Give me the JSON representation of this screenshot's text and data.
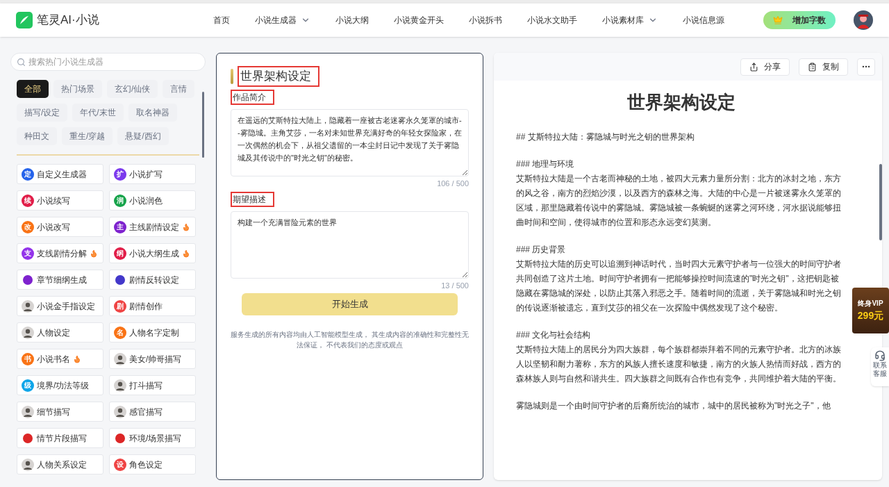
{
  "header": {
    "logo_text": "笔灵AI·小说",
    "nav": [
      {
        "label": "首页",
        "dropdown": false
      },
      {
        "label": "小说生成器",
        "dropdown": true
      },
      {
        "label": "小说大纲",
        "dropdown": false
      },
      {
        "label": "小说黄金开头",
        "dropdown": false
      },
      {
        "label": "小说拆书",
        "dropdown": false
      },
      {
        "label": "小说水文助手",
        "dropdown": false
      },
      {
        "label": "小说素材库",
        "dropdown": true
      },
      {
        "label": "小说信息源",
        "dropdown": false
      }
    ],
    "cta": "增加字数"
  },
  "sidebar": {
    "search_placeholder": "搜索热门小说生成器",
    "categories": [
      {
        "label": "全部",
        "selected": true
      },
      {
        "label": "热门场景",
        "selected": false
      },
      {
        "label": "玄幻/仙侠",
        "selected": false
      },
      {
        "label": "言情",
        "selected": false
      },
      {
        "label": "描写/设定",
        "selected": false
      },
      {
        "label": "年代/末世",
        "selected": false
      },
      {
        "label": "取名神器",
        "selected": false
      },
      {
        "label": "种田文",
        "selected": false
      },
      {
        "label": "重生/穿越",
        "selected": false
      },
      {
        "label": "悬疑/西幻",
        "selected": false
      }
    ],
    "tools": [
      {
        "label": "自定义生成器",
        "kind": "glyph",
        "glyph": "定",
        "color": "#2563eb",
        "hot": false
      },
      {
        "label": "小说扩写",
        "kind": "glyph",
        "glyph": "扩",
        "color": "#7c3aed",
        "hot": false
      },
      {
        "label": "小说续写",
        "kind": "glyph",
        "glyph": "续",
        "color": "#e11d48",
        "hot": false
      },
      {
        "label": "小说润色",
        "kind": "glyph",
        "glyph": "润",
        "color": "#16a34a",
        "hot": false
      },
      {
        "label": "小说改写",
        "kind": "glyph",
        "glyph": "改",
        "color": "#f97316",
        "hot": false
      },
      {
        "label": "主线剧情设定",
        "kind": "glyph",
        "glyph": "主",
        "color": "#7e22ce",
        "hot": true
      },
      {
        "label": "支线剧情分解",
        "kind": "glyph",
        "glyph": "支",
        "color": "#9333ea",
        "hot": true
      },
      {
        "label": "小说大纲生成",
        "kind": "glyph",
        "glyph": "纲",
        "color": "#e11d48",
        "hot": true
      },
      {
        "label": "章节细纲生成",
        "kind": "badge",
        "color": "#7e22ce",
        "hot": false
      },
      {
        "label": "剧情反转设定",
        "kind": "badge",
        "color": "#4338ca",
        "hot": false
      },
      {
        "label": "小说金手指设定",
        "kind": "avatar",
        "hot": false
      },
      {
        "label": "剧情创作",
        "kind": "glyph",
        "glyph": "剧",
        "color": "#ef4444",
        "hot": false
      },
      {
        "label": "人物设定",
        "kind": "avatar",
        "hot": false
      },
      {
        "label": "人物名字定制",
        "kind": "glyph",
        "glyph": "名",
        "color": "#f97316",
        "hot": false
      },
      {
        "label": "小说书名",
        "kind": "glyph",
        "glyph": "书",
        "color": "#f97316",
        "hot": true
      },
      {
        "label": "美女/帅哥描写",
        "kind": "avatar",
        "hot": false
      },
      {
        "label": "境界/功法等级",
        "kind": "glyph",
        "glyph": "级",
        "color": "#0ea5e9",
        "hot": false
      },
      {
        "label": "打斗描写",
        "kind": "avatar",
        "hot": false
      },
      {
        "label": "细节描写",
        "kind": "avatar",
        "hot": false
      },
      {
        "label": "感官描写",
        "kind": "avatar",
        "hot": false
      },
      {
        "label": "情节片段描写",
        "kind": "badge",
        "color": "#dc2626",
        "hot": false
      },
      {
        "label": "环境/场景描写",
        "kind": "badge",
        "color": "#dc2626",
        "hot": false
      },
      {
        "label": "人物关系设定",
        "kind": "avatar",
        "hot": false
      },
      {
        "label": "角色设定",
        "kind": "glyph",
        "glyph": "设",
        "color": "#ef4444",
        "hot": false
      }
    ]
  },
  "form": {
    "title": "世界架构设定",
    "title_highlighted": true,
    "fields": [
      {
        "label": "作品简介",
        "highlighted": true,
        "value": "在遥远的艾斯特拉大陆上，隐藏着一座被古老迷雾永久笼罩的城市--雾隐城。主角艾莎，一名对未知世界充满好奇的年轻女探险家，在一次偶然的机会下，从祖父遗留的一本尘封日记中发现了关于雾隐城及其传说中的\"时光之钥\"的秘密。",
        "count": "106 / 500"
      },
      {
        "label": "期望描述",
        "highlighted": true,
        "value": "构建一个充满冒险元素的世界",
        "count": "13 / 500"
      }
    ],
    "submit": "开始生成",
    "disclaimer": "服务生成的所有内容均由人工智能模型生成， 其生成内容的准确性和完整性无法保证， 不代表我们的态度或观点"
  },
  "result": {
    "actions": [
      "分享",
      "复制"
    ],
    "title": "世界架构设定",
    "blocks": [
      {
        "kind": "heading",
        "text": "## 艾斯特拉大陆：雾隐城与时光之钥的世界架构"
      },
      {
        "kind": "heading",
        "text": "### 地理与环境"
      },
      {
        "kind": "paragraph",
        "text": "艾斯特拉大陆是一个古老而神秘的土地，被四大元素力量所分割：北方的冰封之地，东方的风之谷，南方的烈焰沙漠，以及西方的森林之海。大陆的中心是一片被迷雾永久笼罩的区域，那里隐藏着传说中的雾隐城。雾隐城被一条蜿蜒的迷雾之河环绕，河水据说能够扭曲时间和空间，使得城市的位置和形态永远变幻莫测。"
      },
      {
        "kind": "heading",
        "text": "### 历史背景"
      },
      {
        "kind": "paragraph",
        "text": "艾斯特拉大陆的历史可以追溯到神话时代，当时四大元素守护者与一位强大的时间守护者共同创造了这片土地。时间守护者拥有一把能够操控时间流速的\"时光之钥\"，这把钥匙被隐藏在雾隐城的深处，以防止其落入邪恶之手。随着时间的流逝，关于雾隐城和时光之钥的传说逐渐被遗忘，直到艾莎的祖父在一次探险中偶然发现了这个秘密。"
      },
      {
        "kind": "heading",
        "text": "### 文化与社会结构"
      },
      {
        "kind": "paragraph",
        "text": "艾斯特拉大陆上的居民分为四大族群，每个族群都崇拜着不同的元素守护者。北方的冰族人以坚韧和耐力著称，东方的风族人擅长速度和敏捷，南方的火族人热情而好战，西方的森林族人则与自然和谐共生。四大族群之间既有合作也有竞争，共同维护着大陆的平衡。"
      },
      {
        "kind": "paragraph",
        "text": "雾隐城则是一个由时间守护者的后裔所统治的城市，城中的居民被称为\"时光之子\"，他"
      }
    ]
  },
  "promo": {
    "line1": "终身VIP",
    "line2": "299元"
  },
  "support": "联系客服"
}
